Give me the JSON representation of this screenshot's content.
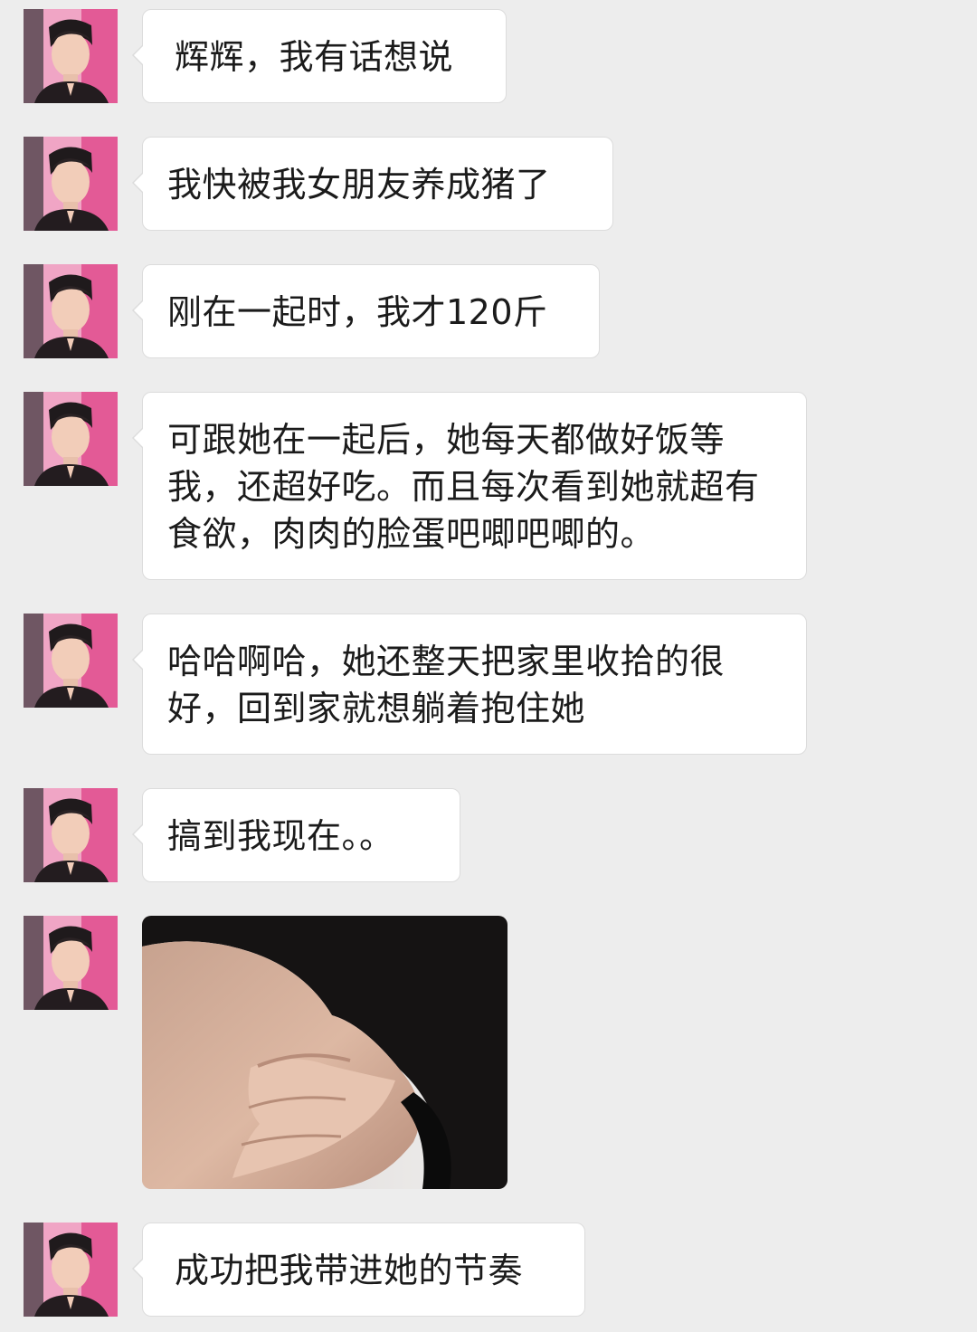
{
  "chat": {
    "messages": [
      {
        "type": "text",
        "text": "辉辉，我有话想说"
      },
      {
        "type": "text",
        "text": "我快被我女朋友养成猪了"
      },
      {
        "type": "text",
        "text": "刚在一起时，我才120斤"
      },
      {
        "type": "text",
        "text": "可跟她在一起后，她每天都做好饭等我，还超好吃。而且每次看到她就超有食欲，肉肉的脸蛋吧唧吧唧的。"
      },
      {
        "type": "text",
        "text": "哈哈啊哈，她还整天把家里收拾的很好，回到家就想躺着抱住她"
      },
      {
        "type": "text",
        "text": "搞到我现在。。"
      },
      {
        "type": "image",
        "icon": "photo-of-belly-being-pinched"
      },
      {
        "type": "text",
        "text": "成功把我带进她的节奏"
      }
    ]
  },
  "colors": {
    "background": "#ededed",
    "bubble": "#ffffff",
    "bubble_border": "#dcdcdc",
    "text": "#1b1b1b"
  }
}
